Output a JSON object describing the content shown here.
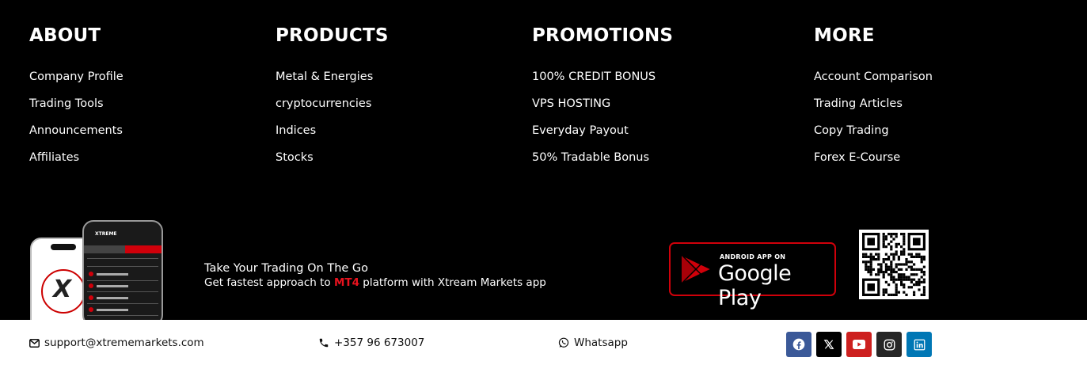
{
  "columns": {
    "about": {
      "heading": "ABOUT",
      "links": [
        "Company Profile",
        "Trading Tools",
        "Announcements",
        "Affiliates"
      ]
    },
    "products": {
      "heading": "PRODUCTS",
      "links": [
        "Metal & Energies",
        "cryptocurrencies",
        "Indices",
        "Stocks"
      ]
    },
    "promotions": {
      "heading": "PROMOTIONS",
      "links": [
        "100% CREDIT BONUS",
        "VPS HOSTING",
        "Everyday Payout",
        "50% Tradable Bonus"
      ]
    },
    "more": {
      "heading": "MORE",
      "links": [
        "Account Comparison",
        "Trading Articles",
        "Copy Trading",
        "Forex E-Course"
      ]
    }
  },
  "app_promo": {
    "title": "Take Your Trading On The Go",
    "subtitle_prefix": "Get fastest approach to ",
    "subtitle_highlight": "MT4",
    "subtitle_suffix": " platform with Xtream Markets app",
    "highlight_color": "#e8121e",
    "phone_brand": "XTREME"
  },
  "google_play": {
    "small_label": "ANDROID APP ON",
    "big_label": "Google Play",
    "border_color": "#d0000a"
  },
  "contacts": {
    "email": "support@xtrememarkets.com",
    "phone": "+357 96 673007",
    "whatsapp": "Whatsapp"
  },
  "socials": [
    {
      "name": "facebook",
      "icon": "facebook-icon",
      "color": "#3b5998"
    },
    {
      "name": "x",
      "icon": "x-icon",
      "color": "#000000"
    },
    {
      "name": "youtube",
      "icon": "youtube-icon",
      "color": "#cd201f"
    },
    {
      "name": "instagram",
      "icon": "instagram-icon",
      "color": "#262626"
    },
    {
      "name": "linkedin",
      "icon": "linkedin-icon",
      "color": "#0077b5"
    }
  ]
}
